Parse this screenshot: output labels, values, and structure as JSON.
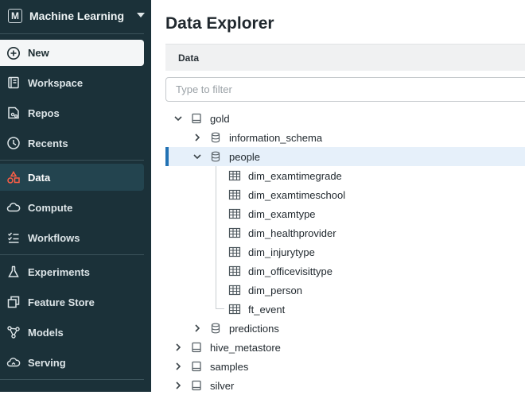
{
  "sidebar": {
    "persona": {
      "badge": "M",
      "label": "Machine Learning"
    },
    "items": [
      {
        "id": "new",
        "label": "New",
        "icon": "plus-circle-icon"
      },
      {
        "id": "workspace",
        "label": "Workspace",
        "icon": "workspace-icon"
      },
      {
        "id": "repos",
        "label": "Repos",
        "icon": "repos-icon"
      },
      {
        "id": "recents",
        "label": "Recents",
        "icon": "clock-icon"
      },
      {
        "id": "data",
        "label": "Data",
        "icon": "data-icon",
        "active": true
      },
      {
        "id": "compute",
        "label": "Compute",
        "icon": "cloud-icon"
      },
      {
        "id": "workflows",
        "label": "Workflows",
        "icon": "workflows-icon"
      },
      {
        "id": "experiments",
        "label": "Experiments",
        "icon": "flask-icon"
      },
      {
        "id": "feature-store",
        "label": "Feature Store",
        "icon": "feature-store-icon"
      },
      {
        "id": "models",
        "label": "Models",
        "icon": "models-icon"
      },
      {
        "id": "serving",
        "label": "Serving",
        "icon": "serving-icon"
      }
    ]
  },
  "main": {
    "title": "Data Explorer",
    "tab": "Data",
    "filter_placeholder": "Type to filter",
    "tree": [
      {
        "label": "gold",
        "type": "catalog",
        "expanded": true
      },
      {
        "label": "information_schema",
        "type": "schema",
        "expanded": false
      },
      {
        "label": "people",
        "type": "schema",
        "expanded": true,
        "selected": true
      },
      {
        "label": "dim_examtimegrade",
        "type": "table"
      },
      {
        "label": "dim_examtimeschool",
        "type": "table"
      },
      {
        "label": "dim_examtype",
        "type": "table"
      },
      {
        "label": "dim_healthprovider",
        "type": "table"
      },
      {
        "label": "dim_injurytype",
        "type": "table"
      },
      {
        "label": "dim_officevisittype",
        "type": "table"
      },
      {
        "label": "dim_person",
        "type": "table"
      },
      {
        "label": "ft_event",
        "type": "table"
      },
      {
        "label": "predictions",
        "type": "schema",
        "expanded": false
      },
      {
        "label": "hive_metastore",
        "type": "catalog",
        "expanded": false
      },
      {
        "label": "samples",
        "type": "catalog",
        "expanded": false
      },
      {
        "label": "silver",
        "type": "catalog",
        "expanded": false
      }
    ]
  },
  "colors": {
    "sidebar_bg": "#1b3139",
    "accent": "#2272b4",
    "data_icon": "#ff5f46"
  }
}
